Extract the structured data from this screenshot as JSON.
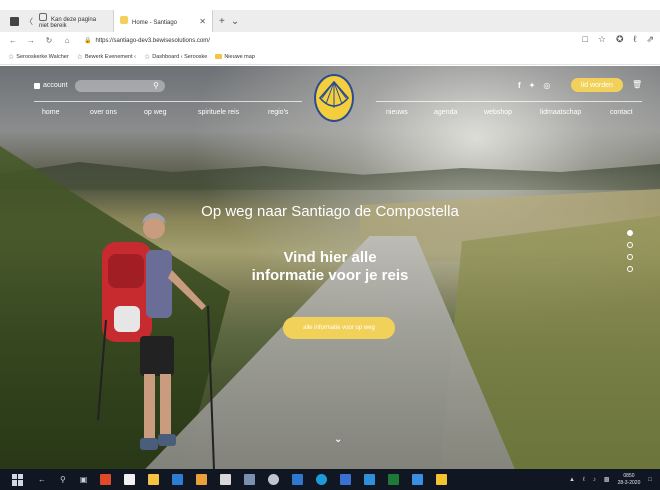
{
  "browser": {
    "tabs": [
      {
        "title": "Kan deze pagina niet bereik",
        "active": false
      },
      {
        "title": "Home - Santiago",
        "active": true
      }
    ],
    "new_tab_symbol": "+",
    "url": "https://santiago-dev3.bewisesolutions.com/",
    "favorites": [
      {
        "label": "Serooskerke Walcher",
        "icon": "star-icon"
      },
      {
        "label": "Bewerk Evenement ‹",
        "icon": "star-icon"
      },
      {
        "label": "Dashboard ‹ Serooske",
        "icon": "star-icon"
      },
      {
        "label": "Nieuwe map",
        "icon": "folder-icon"
      }
    ]
  },
  "header": {
    "account_label": "account",
    "social": [
      "f",
      "♥",
      "◎"
    ],
    "cta_label": "lid worden",
    "nav_left": [
      "home",
      "over ons",
      "op weg",
      "spirituele reis",
      "regio's"
    ],
    "nav_right": [
      "nieuws",
      "agenda",
      "webshop",
      "lidmaatschap",
      "contact"
    ]
  },
  "hero": {
    "title": "Op weg naar Santiago de Compostella",
    "sub_line1": "Vind hier alle",
    "sub_line2": "informatie voor je reis",
    "button_label": "alle informatie voor op weg",
    "active_slide": 0,
    "slide_count": 4
  },
  "taskbar": {
    "time": "0850",
    "date": "28-3-2020"
  },
  "colors": {
    "accent_yellow": "#f2d15a",
    "logo_blue": "#2b4c8f",
    "taskbar": "#101722"
  }
}
